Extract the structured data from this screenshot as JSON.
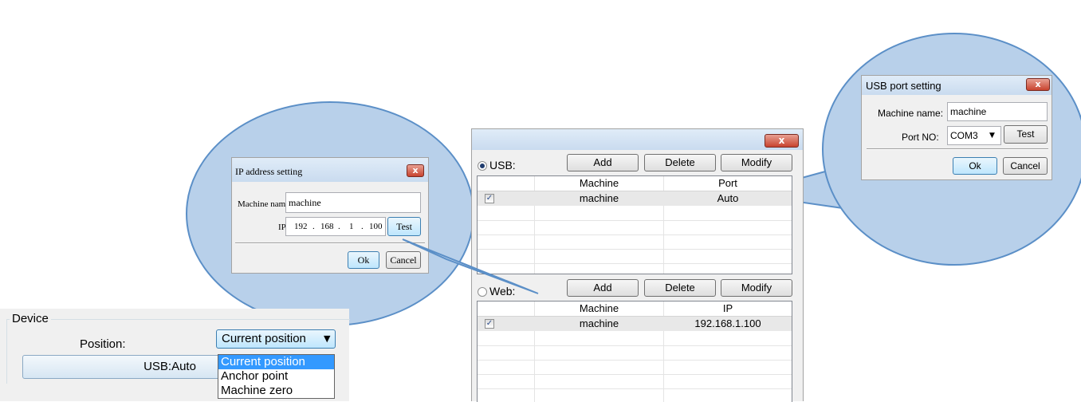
{
  "device_panel": {
    "group_label": "Device",
    "position_label": "Position:",
    "position_selected": "Current position",
    "position_options": [
      "Current position",
      "Anchor point",
      "Machine zero"
    ],
    "connection_button": "USB:Auto"
  },
  "ip_dialog": {
    "title": "IP address setting",
    "close": "x",
    "machine_name_label": "Machine name:",
    "machine_name_value": "machine",
    "ip_label": "IP",
    "ip_octets": [
      "192",
      "168",
      "1",
      "100"
    ],
    "ip_dot": ".",
    "test_label": "Test",
    "ok_label": "Ok",
    "cancel_label": "Cancel"
  },
  "main_dialog": {
    "close": "x",
    "usb": {
      "radio_label": "USB:",
      "selected": true,
      "add_label": "Add",
      "delete_label": "Delete",
      "modify_label": "Modify",
      "columns": [
        "Machine",
        "Port"
      ],
      "rows": [
        {
          "checked": true,
          "machine": "machine",
          "port": "Auto"
        }
      ]
    },
    "web": {
      "radio_label": "Web:",
      "selected": false,
      "add_label": "Add",
      "delete_label": "Delete",
      "modify_label": "Modify",
      "columns": [
        "Machine",
        "IP"
      ],
      "rows": [
        {
          "checked": true,
          "machine": "machine",
          "ip": "192.168.1.100"
        }
      ]
    }
  },
  "usb_dialog": {
    "title": "USB port setting",
    "close": "x",
    "machine_name_label": "Machine name:",
    "machine_name_value": "machine",
    "port_label": "Port NO:",
    "port_value": "COM3",
    "test_label": "Test",
    "ok_label": "Ok",
    "cancel_label": "Cancel"
  },
  "colors": {
    "callout_fill": "#b8d0ea",
    "callout_stroke": "#5b8fc7",
    "selection_blue": "#3399ff",
    "close_red": "#c8432e"
  }
}
